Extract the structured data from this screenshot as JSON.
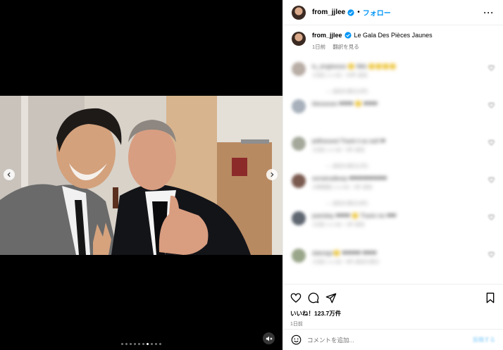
{
  "post": {
    "username": "from_jjlee",
    "follow_label": "フォロー",
    "more_icon": "more-horizontal-icon",
    "separator": "•"
  },
  "caption": {
    "username": "from_jjlee",
    "text": "Le Gala Des Pièces Jaunes",
    "time": "1日前",
    "translate_label": "翻訳を見る"
  },
  "comments": [
    {
      "text": "lu_singleesse 🙂 Mkk 🙂🙂🙂🙂",
      "meta": "1日前   いいね！10件   返信",
      "reply": "—  返信を表示(2件)"
    },
    {
      "text": "blessesee ❤❤❤ 🙂 ❤❤❤",
      "meta": "",
      "reply": ""
    },
    {
      "text": "jeilthessed Thank it as well ❤",
      "meta": "1日前   いいね！5件   返信",
      "reply": "—  返信を表示(1件)"
    },
    {
      "text": "sorrainsdkeep ❤❤❤❤❤❤❤❤",
      "meta": "16時間前   いいね！2件   返信",
      "reply": "—  返信を表示(3件)"
    },
    {
      "text": "jsaintday ❤❤❤ 🙂 Thank me ❤❤",
      "meta": "1日前   いいね！1件   返信",
      "reply": ""
    },
    {
      "text": "datesign🙂 ❤❤❤❤ ❤❤❤",
      "meta": "1日前   いいね！9件   返信を表示",
      "reply": ""
    }
  ],
  "actions": {
    "likes_text": "いいね！123.7万件",
    "date": "1日前"
  },
  "add_comment": {
    "placeholder": "コメントを追加...",
    "post_label": "投稿する"
  },
  "carousel": {
    "dot_count": 10,
    "active_index": 6
  },
  "colors": {
    "accent": "#0095f6",
    "media_bg": "#000000",
    "verified": "#0095f6"
  }
}
